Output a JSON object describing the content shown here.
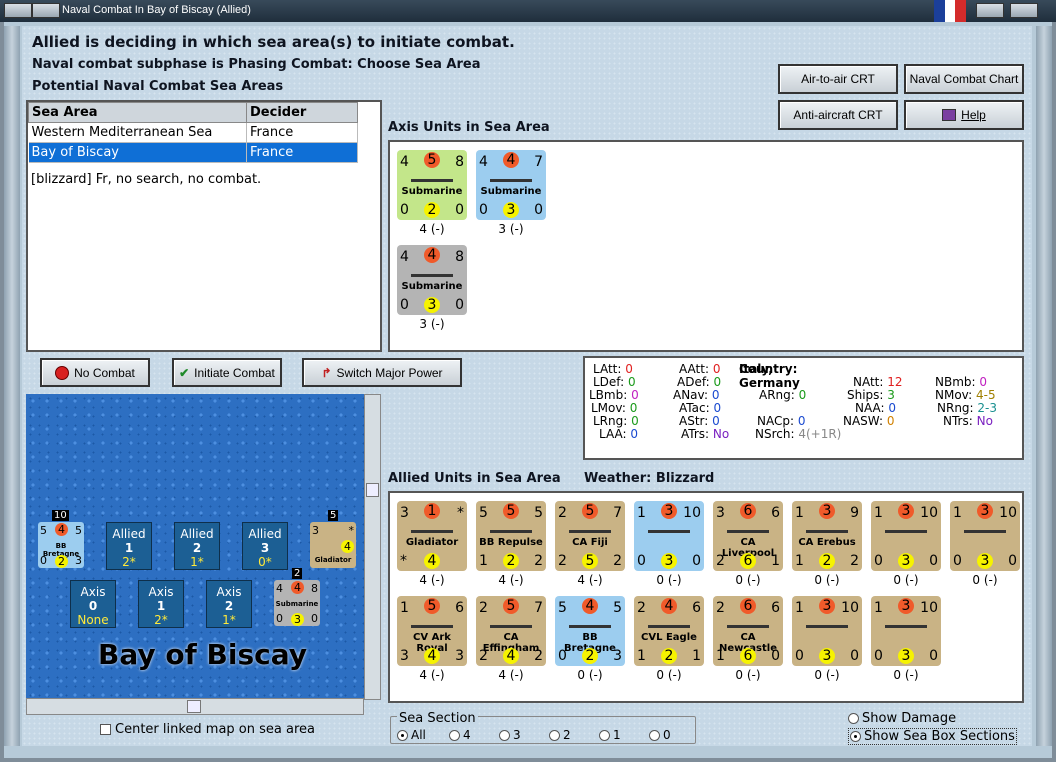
{
  "window": {
    "title": "Naval Combat In Bay of Biscay (Allied)"
  },
  "header": {
    "line1": "Allied is deciding in which sea area(s) to initiate combat.",
    "line2": "Naval combat subphase is Phasing Combat: Choose Sea Area",
    "line3": "Potential Naval Combat Sea Areas"
  },
  "chart_buttons": {
    "air_crt": "Air-to-air CRT",
    "naval_chart": "Naval Combat Chart",
    "aa_crt": "Anti-aircraft CRT",
    "help": "Help"
  },
  "sea_table": {
    "headers": [
      "Sea Area",
      "Decider"
    ],
    "rows": [
      {
        "area": "Western Mediterranean Sea",
        "decider": "France"
      },
      {
        "area": "Bay of Biscay",
        "decider": "France"
      }
    ],
    "note": "[blizzard]  Fr, no search, no combat."
  },
  "axis_units": {
    "label": "Axis Units in Sea Area",
    "items": [
      {
        "tl": "4",
        "tc": "5",
        "tr": "8",
        "name": "Submarine",
        "bl": "0",
        "bc": "2",
        "br": "0",
        "cap": "4 (-)"
      },
      {
        "tl": "4",
        "tc": "4",
        "tr": "7",
        "name": "Submarine",
        "bl": "0",
        "bc": "3",
        "br": "0",
        "cap": "3 (-)"
      },
      {
        "tl": "4",
        "tc": "4",
        "tr": "8",
        "name": "Submarine",
        "bl": "0",
        "bc": "3",
        "br": "0",
        "cap": "3 (-)"
      }
    ]
  },
  "action_buttons": {
    "no_combat": "No Combat",
    "initiate": "Initiate Combat",
    "switch": "Switch Major Power"
  },
  "stats": {
    "country_label": "Country:",
    "country": "Italy, Germany",
    "LAtt": "0",
    "LDef": "0",
    "LBmb": "0",
    "LMov": "0",
    "LRng": "0",
    "LAA": "0",
    "AAtt": "0",
    "ADef": "0",
    "ANav": "0",
    "ATac": "0",
    "AStr": "0",
    "ATrs": "No",
    "ARng": "0",
    "NACp": "0",
    "NSrch": "4(+1R)",
    "NAtt": "12",
    "Ships": "3",
    "NAA": "0",
    "NASW": "0",
    "NBmb": "0",
    "NMov": "4-5",
    "NRng": "2-3",
    "NTrs": "No"
  },
  "allied_units": {
    "label": "Allied Units in Sea Area",
    "weather_label": "Weather:",
    "weather": "Blizzard",
    "row1": [
      {
        "tl": "3",
        "tc": "1",
        "tr": "*",
        "name": "Gladiator",
        "bl": "*",
        "bc": "4",
        "br": "",
        "cap": "4 (-)",
        "color": "tan"
      },
      {
        "tl": "5",
        "tc": "5",
        "tr": "5",
        "name": "BB Repulse",
        "bl": "1",
        "bc": "2",
        "br": "2",
        "cap": "4 (-)",
        "color": "tan"
      },
      {
        "tl": "2",
        "tc": "5",
        "tr": "7",
        "name": "CA Fiji",
        "bl": "2",
        "bc": "5",
        "br": "2",
        "cap": "4 (-)",
        "color": "tan"
      },
      {
        "tl": "1",
        "tc": "3",
        "tr": "10",
        "name": "",
        "bl": "0",
        "bc": "3",
        "br": "0",
        "cap": "0 (-)",
        "color": "blue"
      },
      {
        "tl": "3",
        "tc": "6",
        "tr": "6",
        "name": "CA Liverpool",
        "bl": "2",
        "bc": "6",
        "br": "1",
        "cap": "0 (-)",
        "color": "tan"
      },
      {
        "tl": "1",
        "tc": "3",
        "tr": "9",
        "name": "CA Erebus",
        "bl": "1",
        "bc": "2",
        "br": "2",
        "cap": "0 (-)",
        "color": "tan"
      },
      {
        "tl": "1",
        "tc": "3",
        "tr": "10",
        "name": "",
        "bl": "0",
        "bc": "3",
        "br": "0",
        "cap": "0 (-)",
        "color": "tan"
      },
      {
        "tl": "1",
        "tc": "3",
        "tr": "10",
        "name": "",
        "bl": "0",
        "bc": "3",
        "br": "0",
        "cap": "0 (-)",
        "color": "tan"
      }
    ],
    "row2": [
      {
        "tl": "1",
        "tc": "5",
        "tr": "6",
        "name": "CV Ark Royal",
        "bl": "3",
        "bc": "4",
        "br": "3",
        "cap": "4 (-)",
        "color": "tan"
      },
      {
        "tl": "2",
        "tc": "5",
        "tr": "7",
        "name": "CA Effingham",
        "bl": "2",
        "bc": "4",
        "br": "2",
        "cap": "4 (-)",
        "color": "tan"
      },
      {
        "tl": "5",
        "tc": "4",
        "tr": "5",
        "name": "BB Bretagne",
        "bl": "0",
        "bc": "2",
        "br": "3",
        "cap": "0 (-)",
        "color": "blue"
      },
      {
        "tl": "2",
        "tc": "4",
        "tr": "6",
        "name": "CVL Eagle",
        "bl": "1",
        "bc": "2",
        "br": "1",
        "cap": "0 (-)",
        "color": "tan"
      },
      {
        "tl": "2",
        "tc": "6",
        "tr": "6",
        "name": "CA Newcastle",
        "bl": "1",
        "bc": "6",
        "br": "0",
        "cap": "0 (-)",
        "color": "tan"
      },
      {
        "tl": "1",
        "tc": "3",
        "tr": "10",
        "name": "",
        "bl": "0",
        "bc": "3",
        "br": "0",
        "cap": "0 (-)",
        "color": "tan"
      },
      {
        "tl": "1",
        "tc": "3",
        "tr": "10",
        "name": "",
        "bl": "0",
        "bc": "3",
        "br": "0",
        "cap": "0 (-)",
        "color": "tan"
      }
    ]
  },
  "map": {
    "title": "Bay of Biscay",
    "allied_boxes": [
      {
        "label": "Allied",
        "value": "1",
        "sub": "2*"
      },
      {
        "label": "Allied",
        "value": "2",
        "sub": "1*"
      },
      {
        "label": "Allied",
        "value": "3",
        "sub": "0*"
      }
    ],
    "axis_boxes": [
      {
        "label": "Axis",
        "value": "0",
        "sub": "None"
      },
      {
        "label": "Axis",
        "value": "1",
        "sub": "2*"
      },
      {
        "label": "Axis",
        "value": "2",
        "sub": "1*"
      }
    ],
    "stack_counts": [
      "10",
      "5",
      "2"
    ],
    "counter_bb": {
      "tl": "5",
      "tc": "4",
      "tr": "5",
      "name": "BB Bretagne",
      "bl": "0",
      "bc": "2",
      "br": "3"
    },
    "counter_glad": {
      "tl": "3",
      "tr": "*",
      "name": "Gladiator",
      "bc": "4"
    },
    "counter_sub": {
      "tl": "4",
      "tc": "4",
      "tr": "8",
      "name": "Submarine",
      "bl": "0",
      "bc": "3",
      "br": "0"
    }
  },
  "center_linked": "Center linked map on sea area",
  "sea_section": {
    "label": "Sea Section",
    "options": [
      "All",
      "4",
      "3",
      "2",
      "1",
      "0"
    ],
    "selected": "All"
  },
  "show_damage": "Show Damage",
  "show_boxes": "Show Sea Box Sections",
  "colors": {
    "selected_row": "#0f6fd6",
    "attack_circle": "#f05a2a",
    "defense_circle": "#f6f300"
  }
}
